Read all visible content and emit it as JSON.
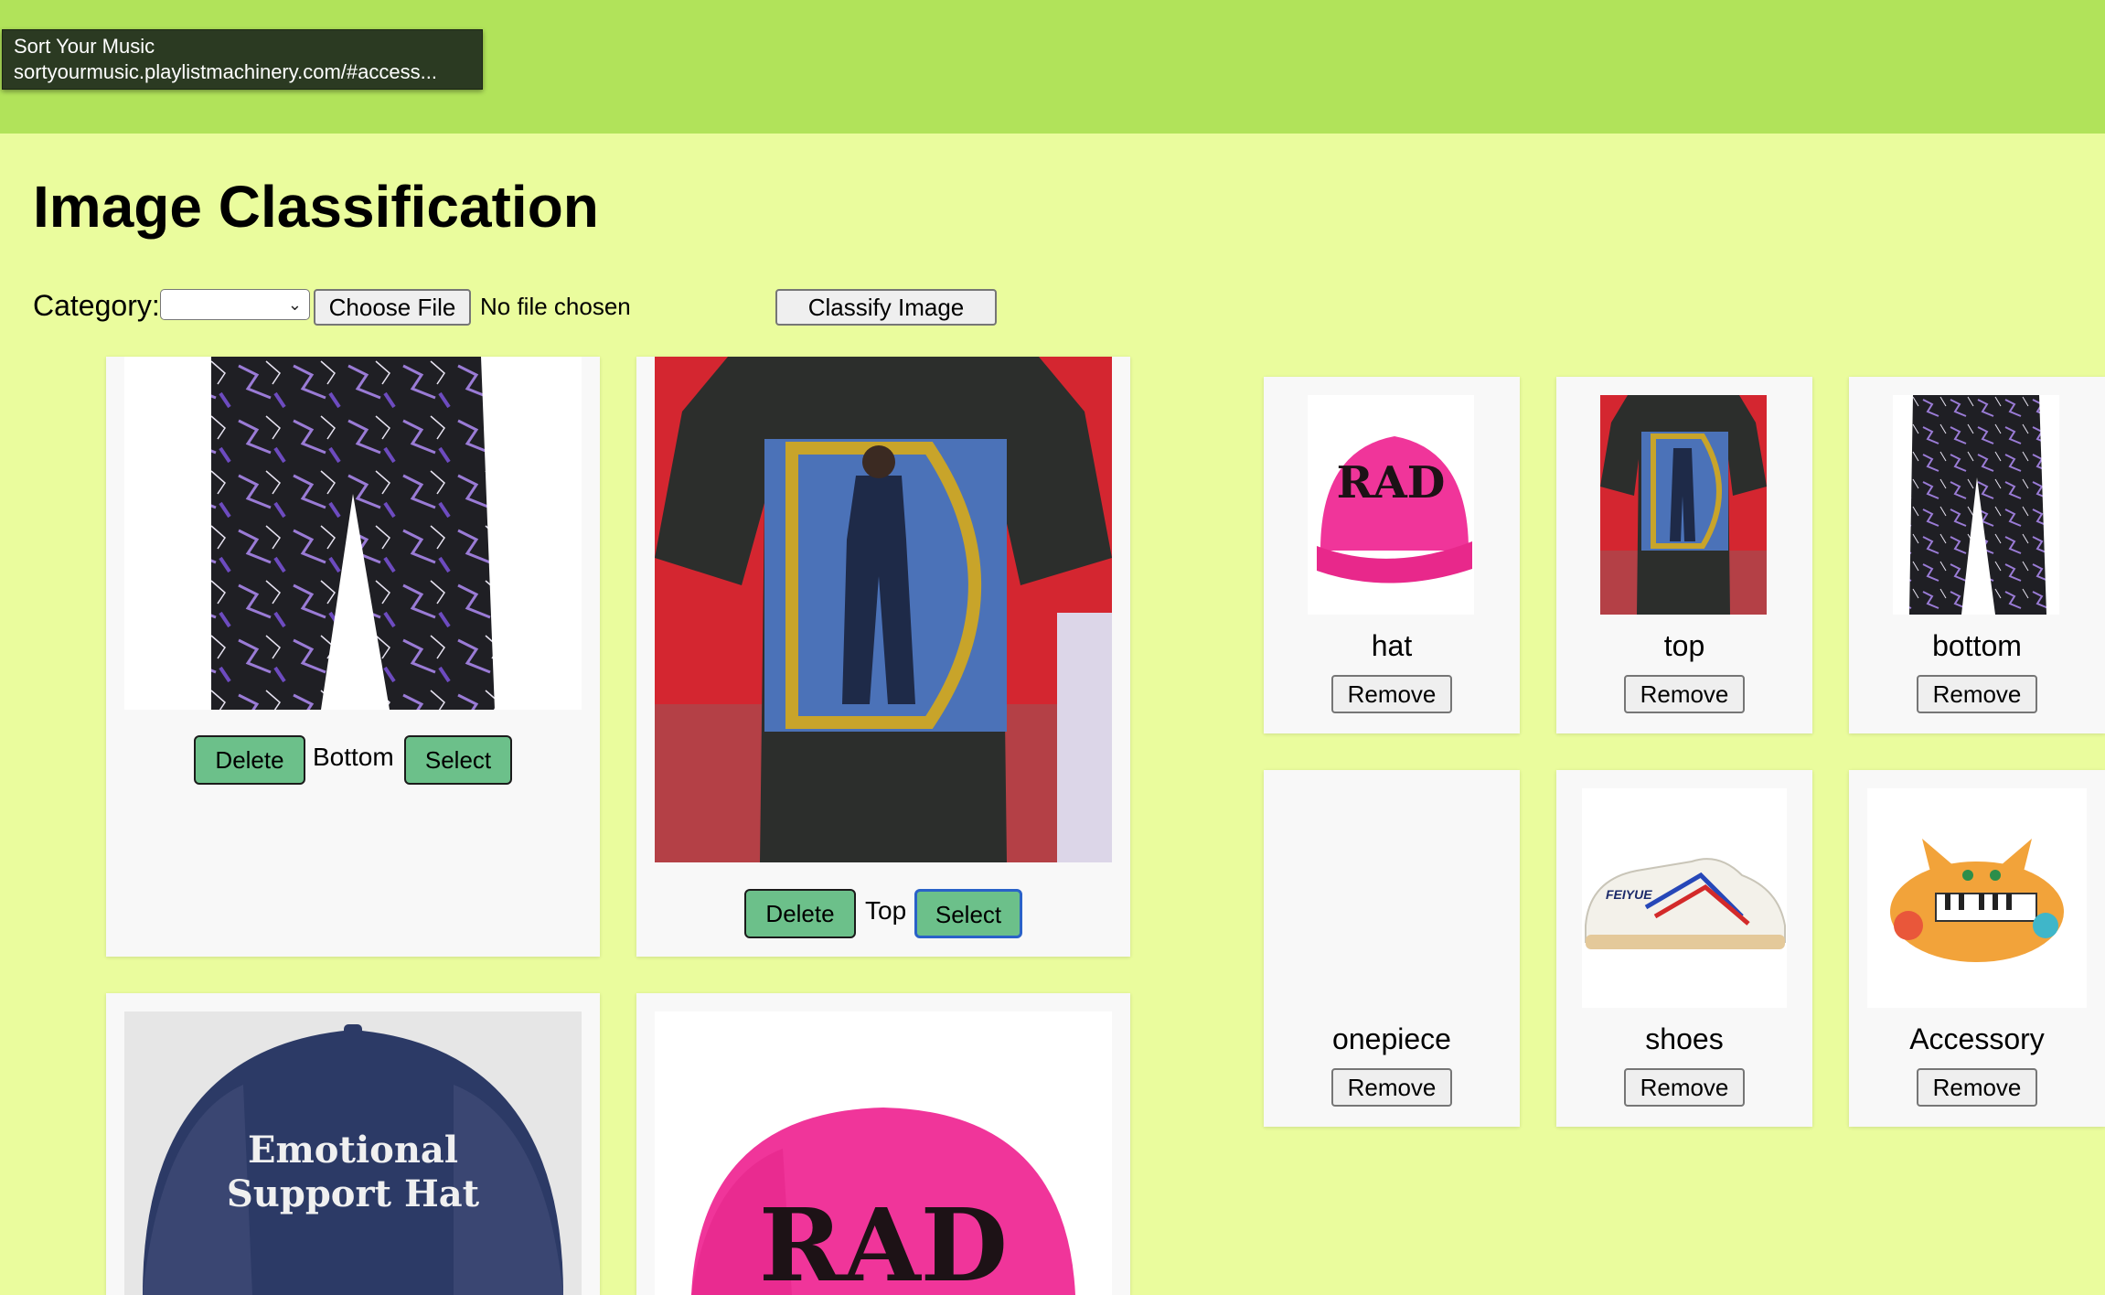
{
  "tooltip": {
    "title": "Sort Your Music",
    "url": "sortyourmusic.playlistmachinery.com/#access..."
  },
  "page": {
    "title": "Image Classification"
  },
  "form": {
    "category_label": "Category:",
    "category_value": "",
    "choose_file_label": "Choose File",
    "no_file_text": "No file chosen",
    "classify_label": "Classify Image"
  },
  "items": [
    {
      "category": "Bottom",
      "delete_label": "Delete",
      "select_label": "Select",
      "image_icon": "lightning-pants-image"
    },
    {
      "category": "Top",
      "delete_label": "Delete",
      "select_label": "Select",
      "image_icon": "graphic-tshirt-image"
    },
    {
      "category": "",
      "image_icon": "emotional-support-hat-image",
      "image_text_line1": "Emotional",
      "image_text_line2": "Support Hat"
    },
    {
      "category": "",
      "image_icon": "pink-rad-hat-image",
      "image_text": "RAD"
    }
  ],
  "categories": [
    {
      "name": "hat",
      "remove_label": "Remove",
      "image_icon": "pink-rad-hat-thumb",
      "image_text": "RAD"
    },
    {
      "name": "top",
      "remove_label": "Remove",
      "image_icon": "tshirt-thumb"
    },
    {
      "name": "bottom",
      "remove_label": "Remove",
      "image_icon": "lightning-pants-thumb"
    },
    {
      "name": "onepiece",
      "remove_label": "Remove",
      "image_icon": ""
    },
    {
      "name": "shoes",
      "remove_label": "Remove",
      "image_icon": "sneaker-thumb",
      "image_text": "FEIYUE"
    },
    {
      "name": "Accessory",
      "remove_label": "Remove",
      "image_icon": "cat-piano-thumb"
    }
  ],
  "colors": {
    "page_bg": "#eafc9d",
    "topbar_bg": "#b1e35a",
    "green_button": "#6cc08a",
    "selected_outline": "#2a62c8",
    "hat_pink": "#f0359a",
    "navy_hat": "#2c3a66"
  }
}
